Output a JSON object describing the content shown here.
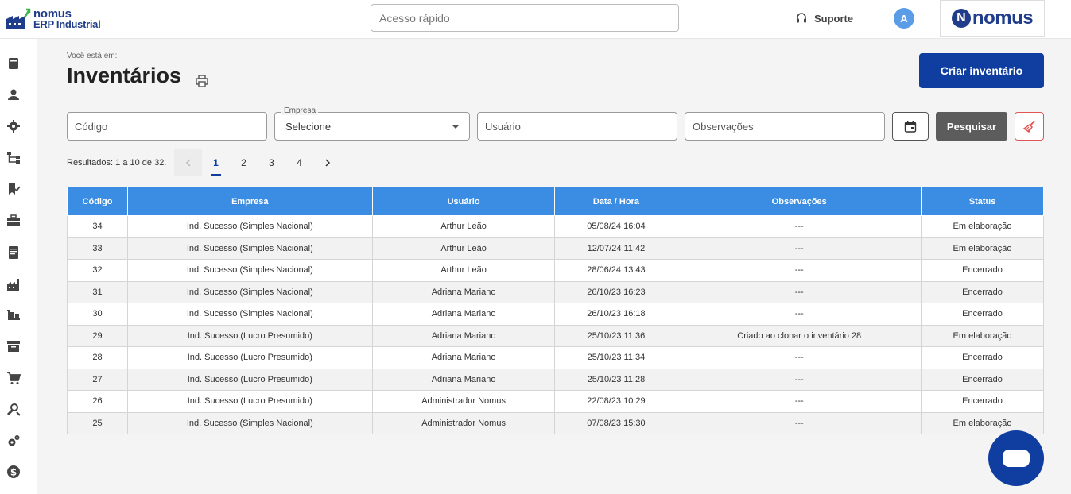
{
  "brand": {
    "line1": "nomus",
    "line2": "ERP Industrial",
    "logo_word": "nomus",
    "logo_letter": "N",
    "color": "#1f3d8a"
  },
  "header": {
    "quick_access_placeholder": "Acesso rápido",
    "support_label": "Suporte",
    "avatar_initial": "A"
  },
  "sidebar": {
    "icons": [
      "book-icon",
      "user-icon",
      "gear-icon",
      "hierarchy-icon",
      "bookmark-check-icon",
      "briefcase-icon",
      "document-list-icon",
      "factory-icon",
      "warehouse-icon",
      "archive-box-icon",
      "cart-icon",
      "tools-icon",
      "settings-gears-icon",
      "dollar-icon"
    ]
  },
  "page": {
    "breadcrumb": "Você está em:",
    "title": "Inventários",
    "create_button": "Criar inventário"
  },
  "filters": {
    "codigo_placeholder": "Código",
    "empresa_label": "Empresa",
    "empresa_value": "Selecione",
    "usuario_placeholder": "Usuário",
    "observacoes_placeholder": "Observações",
    "search_button": "Pesquisar"
  },
  "pagination": {
    "results_text": "Resultados: 1 a 10 de 32.",
    "pages": [
      "1",
      "2",
      "3",
      "4"
    ],
    "current": "1"
  },
  "table": {
    "columns": [
      "Código",
      "Empresa",
      "Usuário",
      "Data / Hora",
      "Observações",
      "Status"
    ],
    "rows": [
      [
        "34",
        "Ind. Sucesso (Simples Nacional)",
        "Arthur Leão",
        "05/08/24 16:04",
        "---",
        "Em elaboração"
      ],
      [
        "33",
        "Ind. Sucesso (Simples Nacional)",
        "Arthur Leão",
        "12/07/24 11:42",
        "---",
        "Em elaboração"
      ],
      [
        "32",
        "Ind. Sucesso (Simples Nacional)",
        "Arthur Leão",
        "28/06/24 13:43",
        "---",
        "Encerrado"
      ],
      [
        "31",
        "Ind. Sucesso (Simples Nacional)",
        "Adriana Mariano",
        "26/10/23 16:23",
        "---",
        "Encerrado"
      ],
      [
        "30",
        "Ind. Sucesso (Simples Nacional)",
        "Adriana Mariano",
        "26/10/23 16:18",
        "---",
        "Encerrado"
      ],
      [
        "29",
        "Ind. Sucesso (Lucro Presumido)",
        "Adriana Mariano",
        "25/10/23 11:36",
        "Criado ao clonar o inventário 28",
        "Em elaboração"
      ],
      [
        "28",
        "Ind. Sucesso (Lucro Presumido)",
        "Adriana Mariano",
        "25/10/23 11:34",
        "---",
        "Encerrado"
      ],
      [
        "27",
        "Ind. Sucesso (Lucro Presumido)",
        "Adriana Mariano",
        "25/10/23 11:28",
        "---",
        "Encerrado"
      ],
      [
        "26",
        "Ind. Sucesso (Lucro Presumido)",
        "Administrador Nomus",
        "22/08/23 10:29",
        "---",
        "Encerrado"
      ],
      [
        "25",
        "Ind. Sucesso (Simples Nacional)",
        "Administrador Nomus",
        "07/08/23 15:30",
        "---",
        "Em elaboração"
      ]
    ]
  },
  "colors": {
    "primary": "#0f3da0",
    "header_blue": "#3a8de3",
    "avatar": "#5b9ce6",
    "danger": "#e05555"
  }
}
